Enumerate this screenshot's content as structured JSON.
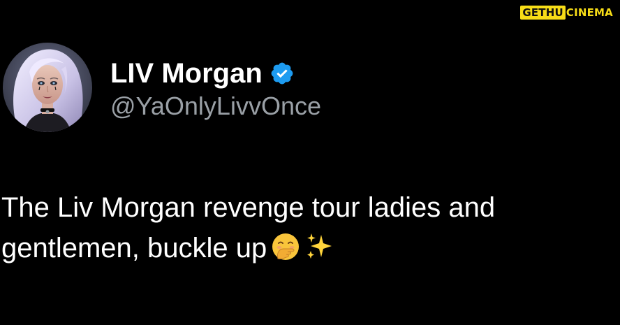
{
  "watermark": {
    "box_text": "GETHU",
    "text": "CINEMA",
    "color": "#f7dd17"
  },
  "profile": {
    "display_name": "LIV Morgan",
    "handle": "@YaOnlyLivvOnce",
    "verified_icon": "verified-badge-icon",
    "verified_color": "#1d9bf0"
  },
  "tweet": {
    "text": "The Liv Morgan revenge tour ladies and gentlemen, buckle up",
    "emojis": [
      "face-with-hand-over-mouth-icon",
      "sparkles-icon"
    ]
  }
}
